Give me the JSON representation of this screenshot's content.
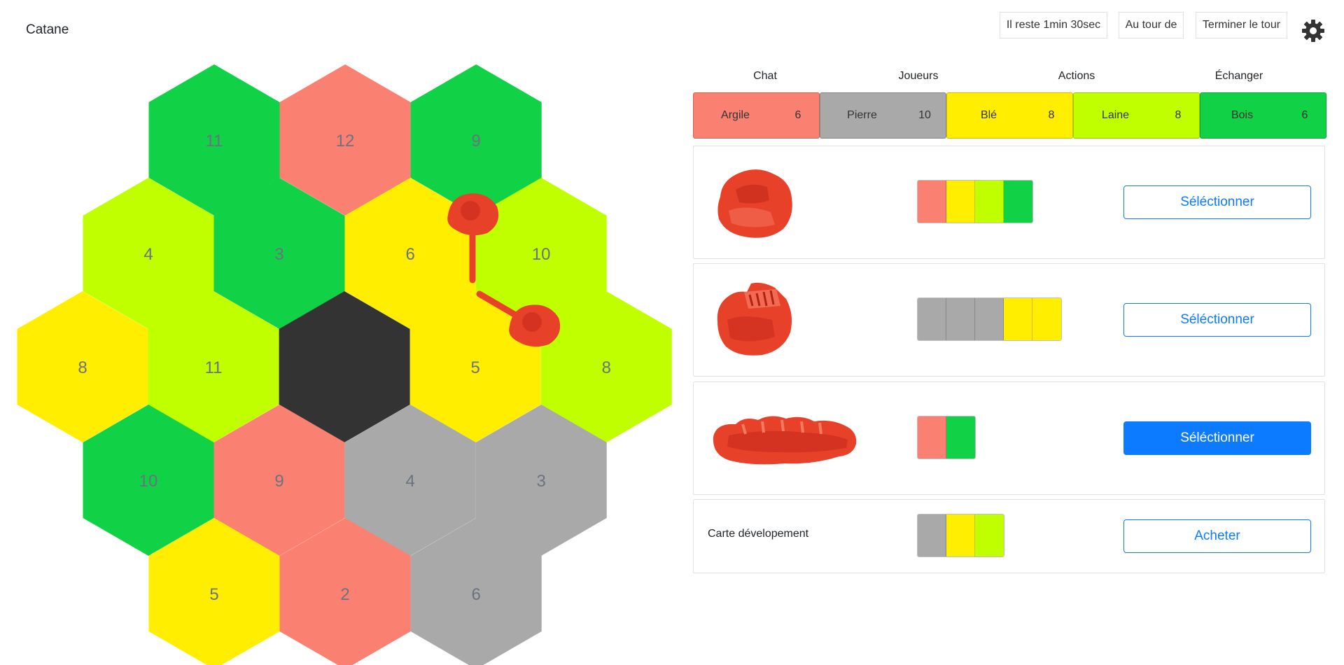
{
  "app": {
    "title": "Catane"
  },
  "header": {
    "timer_label": "Il reste 1min 30sec",
    "turn_label": "Au tour de",
    "end_turn_label": "Terminer le tour"
  },
  "tabs": [
    "Chat",
    "Joueurs",
    "Actions",
    "Échanger"
  ],
  "colors": {
    "argile": "#fa8072",
    "pierre": "#a9a9a9",
    "ble": "#ffee00",
    "laine": "#bfff00",
    "bois": "#11d146",
    "desert": "#333333",
    "accent": "#0d7bff",
    "player_piece": "#e8412a"
  },
  "resources": [
    {
      "name": "Argile",
      "count": "6",
      "color": "#fa8072"
    },
    {
      "name": "Pierre",
      "count": "10",
      "color": "#a9a9a9"
    },
    {
      "name": "Blé",
      "count": "8",
      "color": "#ffee00"
    },
    {
      "name": "Laine",
      "count": "8",
      "color": "#bfff00"
    },
    {
      "name": "Bois",
      "count": "6",
      "color": "#11d146"
    }
  ],
  "board": {
    "hexes": [
      {
        "row": 0,
        "col": 0,
        "number": "11",
        "resource": "bois"
      },
      {
        "row": 0,
        "col": 1,
        "number": "12",
        "resource": "argile"
      },
      {
        "row": 0,
        "col": 2,
        "number": "9",
        "resource": "bois"
      },
      {
        "row": 1,
        "col": 0,
        "number": "4",
        "resource": "laine"
      },
      {
        "row": 1,
        "col": 1,
        "number": "3",
        "resource": "bois"
      },
      {
        "row": 1,
        "col": 2,
        "number": "6",
        "resource": "ble"
      },
      {
        "row": 1,
        "col": 3,
        "number": "10",
        "resource": "laine"
      },
      {
        "row": 2,
        "col": 0,
        "number": "8",
        "resource": "ble"
      },
      {
        "row": 2,
        "col": 1,
        "number": "11",
        "resource": "laine"
      },
      {
        "row": 2,
        "col": 2,
        "number": "",
        "resource": "desert"
      },
      {
        "row": 2,
        "col": 3,
        "number": "5",
        "resource": "ble"
      },
      {
        "row": 2,
        "col": 4,
        "number": "8",
        "resource": "laine"
      },
      {
        "row": 3,
        "col": 0,
        "number": "10",
        "resource": "bois"
      },
      {
        "row": 3,
        "col": 1,
        "number": "9",
        "resource": "argile"
      },
      {
        "row": 3,
        "col": 2,
        "number": "4",
        "resource": "pierre"
      },
      {
        "row": 3,
        "col": 3,
        "number": "3",
        "resource": "pierre"
      },
      {
        "row": 4,
        "col": 0,
        "number": "5",
        "resource": "ble"
      },
      {
        "row": 4,
        "col": 1,
        "number": "2",
        "resource": "argile"
      },
      {
        "row": 4,
        "col": 2,
        "number": "6",
        "resource": "pierre"
      }
    ]
  },
  "actions": [
    {
      "piece": "colonie",
      "cost": [
        "argile",
        "ble",
        "laine",
        "bois"
      ],
      "button": "Séléctionner",
      "active": false
    },
    {
      "piece": "ville",
      "cost": [
        "pierre",
        "pierre",
        "pierre",
        "ble",
        "ble"
      ],
      "button": "Séléctionner",
      "active": false
    },
    {
      "piece": "route",
      "cost": [
        "argile",
        "bois"
      ],
      "button": "Séléctionner",
      "active": true
    }
  ],
  "dev_card": {
    "label": "Carte dévelopement",
    "cost": [
      "pierre",
      "ble",
      "laine"
    ],
    "button": "Acheter"
  }
}
